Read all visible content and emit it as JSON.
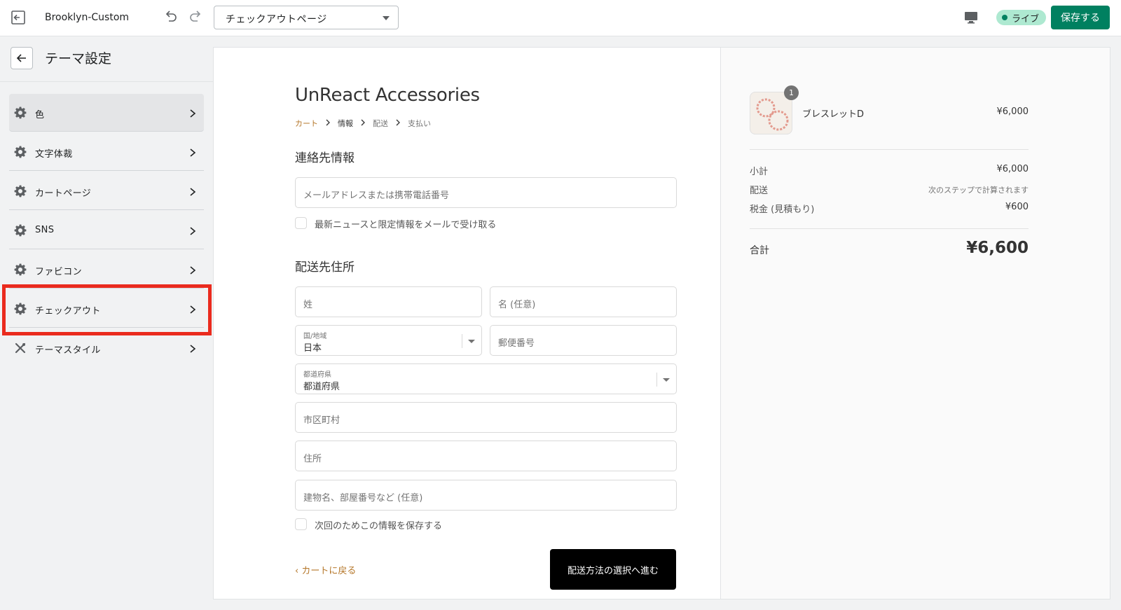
{
  "topbar": {
    "theme_name": "Brooklyn-Custom",
    "page_select": "チェックアウトページ",
    "live_badge": "ライブ",
    "save_label": "保存する"
  },
  "sidebar": {
    "title": "テーマ設定",
    "items": [
      {
        "label": "色",
        "icon": "gear-icon"
      },
      {
        "label": "文字体裁",
        "icon": "gear-icon"
      },
      {
        "label": "カートページ",
        "icon": "gear-icon"
      },
      {
        "label": "SNS",
        "icon": "gear-icon"
      },
      {
        "label": "ファビコン",
        "icon": "gear-icon"
      },
      {
        "label": "チェックアウト",
        "icon": "gear-icon"
      },
      {
        "label": "テーマスタイル",
        "icon": "tools-icon"
      }
    ]
  },
  "checkout": {
    "shop_name": "UnReact Accessories",
    "breadcrumb": [
      "カート",
      "情報",
      "配送",
      "支払い"
    ],
    "contact_title": "連絡先情報",
    "email_placeholder": "メールアドレスまたは携帯電話番号",
    "newsletter_label": "最新ニュースと限定情報をメールで受け取る",
    "shipping_title": "配送先住所",
    "last_name_placeholder": "姓",
    "first_name_placeholder": "名 (任意)",
    "country_label": "国/地域",
    "country_value": "日本",
    "postal_placeholder": "郵便番号",
    "prefecture_label": "都道府県",
    "prefecture_value": "都道府県",
    "city_placeholder": "市区町村",
    "address_placeholder": "住所",
    "building_placeholder": "建物名、部屋番号など (任意)",
    "save_info_label": "次回のためこの情報を保存する",
    "back_link": "カートに戻る",
    "continue_button": "配送方法の選択へ進む"
  },
  "summary": {
    "product": {
      "name": "ブレスレットD",
      "price": "¥6,000",
      "quantity": "1"
    },
    "subtotal_label": "小計",
    "subtotal_value": "¥6,000",
    "shipping_label": "配送",
    "shipping_value": "次のステップで計算されます",
    "tax_label": "税金 (見積もり)",
    "tax_value": "¥600",
    "total_label": "合計",
    "total_value": "¥6,600"
  },
  "colors": {
    "brand_green": "#008060",
    "accent_link": "#b5772a",
    "highlight_red": "#ea2b1e"
  }
}
